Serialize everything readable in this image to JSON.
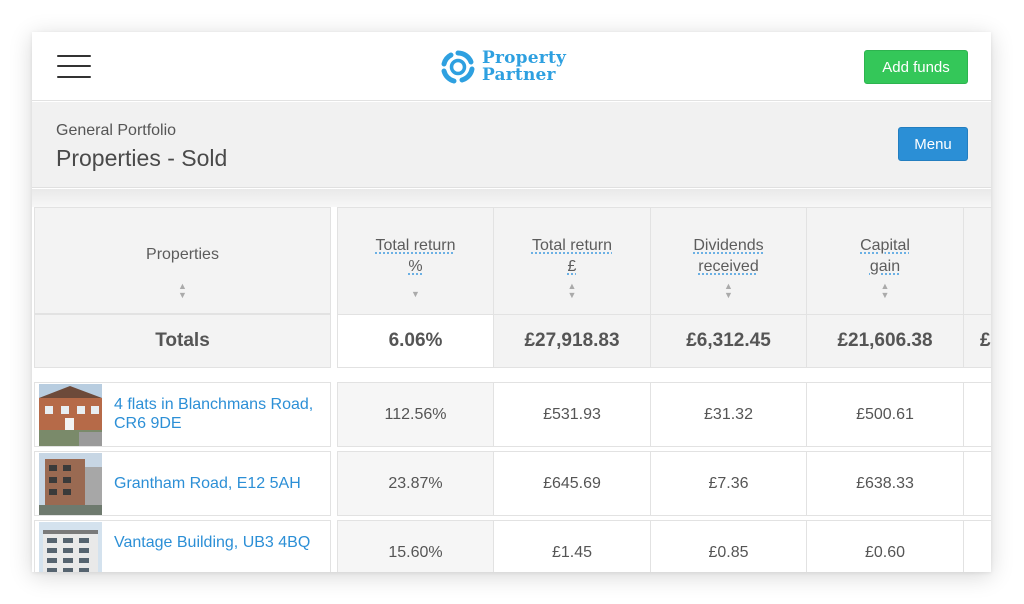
{
  "header": {
    "logo_line1": "Property",
    "logo_line2": "Partner",
    "add_funds_label": "Add funds",
    "logo_color": "#2ea0e0",
    "add_funds_color": "#34c759"
  },
  "subheader": {
    "portfolio": "General Portfolio",
    "title": "Properties - Sold",
    "menu_label": "Menu",
    "menu_color": "#2b8fd6"
  },
  "table": {
    "columns": [
      {
        "line1": "Properties",
        "line2": ""
      },
      {
        "line1": "Total return",
        "line2": "%"
      },
      {
        "line1": "Total return",
        "line2": "£"
      },
      {
        "line1": "Dividends",
        "line2": "received"
      },
      {
        "line1": "Capital",
        "line2": "gain"
      }
    ],
    "totals": {
      "label": "Totals",
      "values": [
        "6.06%",
        "£27,918.83",
        "£6,312.45",
        "£21,606.38",
        "£"
      ]
    },
    "rows": [
      {
        "name": "4 flats in Blanchmans Road, CR6 9DE",
        "values": [
          "112.56%",
          "£531.93",
          "£31.32",
          "£500.61"
        ]
      },
      {
        "name": "Grantham Road, E12 5AH",
        "values": [
          "23.87%",
          "£645.69",
          "£7.36",
          "£638.33"
        ]
      },
      {
        "name": "Vantage Building, UB3 4BQ",
        "values": [
          "15.60%",
          "£1.45",
          "£0.85",
          "£0.60"
        ]
      }
    ]
  }
}
